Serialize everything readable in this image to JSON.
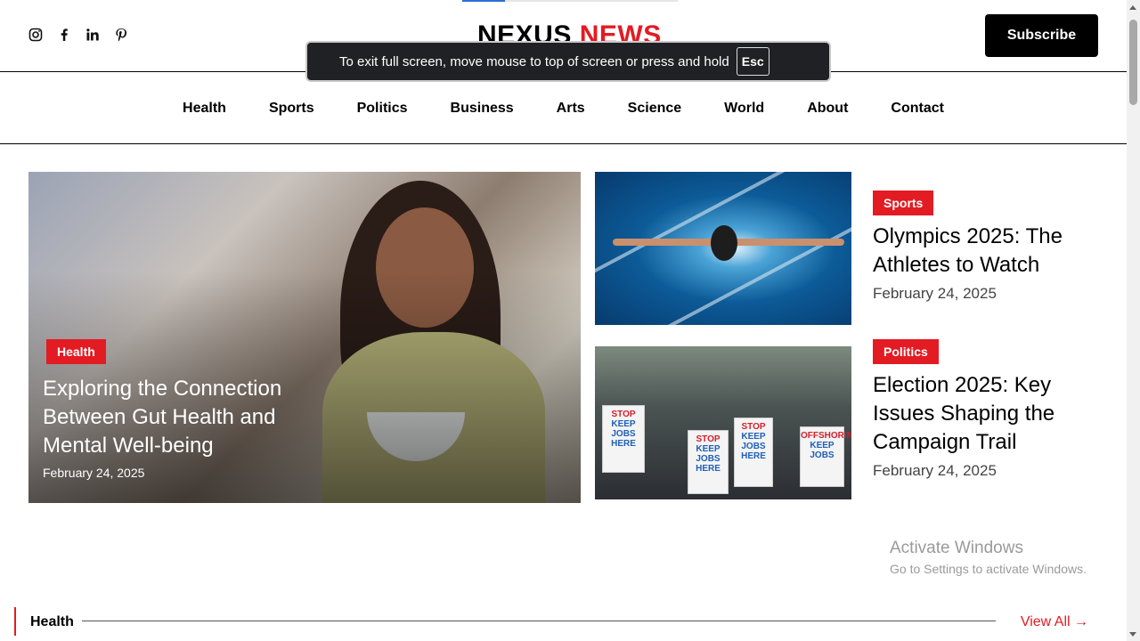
{
  "header": {
    "logo_primary": "NEXUS",
    "logo_accent": "NEWS",
    "subscribe_label": "Subscribe",
    "socials": [
      "instagram-icon",
      "facebook-icon",
      "linkedin-icon",
      "pinterest-icon"
    ],
    "accent_color": "#e31b23"
  },
  "fullscreen_notice": {
    "text": "To exit full screen, move mouse to top of screen or press and hold",
    "key": "Esc"
  },
  "nav": {
    "items": [
      "Health",
      "Sports",
      "Politics",
      "Business",
      "Arts",
      "Science",
      "World",
      "About",
      "Contact"
    ]
  },
  "hero": {
    "category": "Health",
    "title": "Exploring the Connection Between Gut Health and Mental Well-being",
    "date": "February 24, 2025"
  },
  "stories": [
    {
      "category": "Sports",
      "title": "Olympics 2025: The Athletes to Watch",
      "date": "February 24, 2025"
    },
    {
      "category": "Politics",
      "title": "Election 2025: Key Issues Shaping the Campaign Trail",
      "date": "February 24, 2025"
    }
  ],
  "protest_signs": {
    "keep": "KEEP",
    "jobs": "JOBS",
    "here": "HERE",
    "stop": "STOP",
    "offshoring": "OFFSHORING"
  },
  "watermark": {
    "line1": "Activate Windows",
    "line2": "Go to Settings to activate Windows."
  },
  "section": {
    "title": "Health",
    "view_all": "View All →"
  }
}
